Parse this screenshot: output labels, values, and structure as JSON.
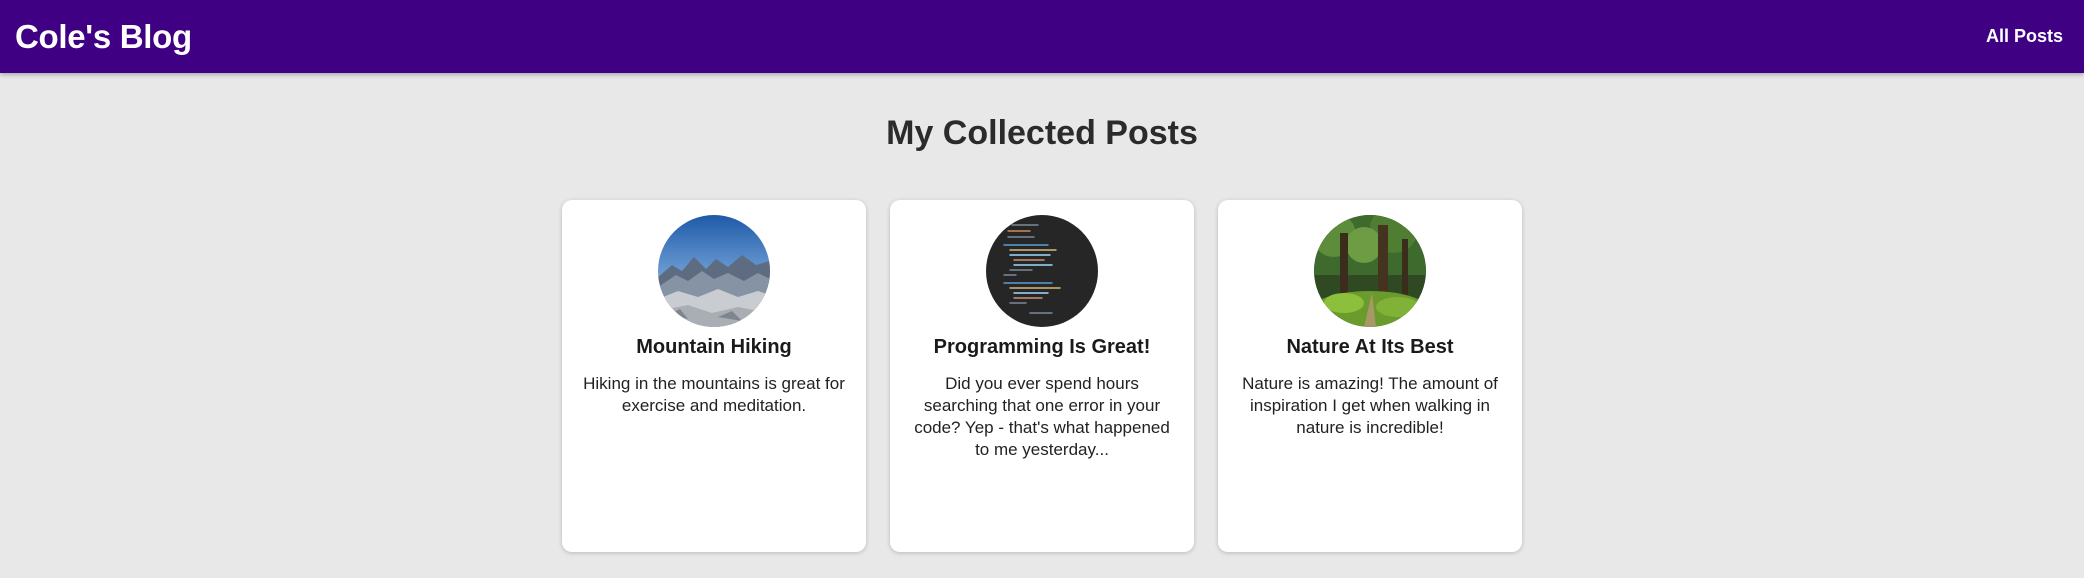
{
  "header": {
    "site_title": "Cole's Blog",
    "nav_all_posts": "All Posts",
    "background": "#3f0083"
  },
  "main": {
    "title": "My Collected Posts"
  },
  "posts": [
    {
      "title": "Mountain Hiking",
      "excerpt": "Hiking in the mountains is great for exercise and meditation.",
      "image": "mountains-photo"
    },
    {
      "title": "Programming Is Great!",
      "excerpt": "Did you ever spend hours searching that one error in your code? Yep - that's what happened to me yesterday...",
      "image": "code-screenshot"
    },
    {
      "title": "Nature At Its Best",
      "excerpt": "Nature is amazing! The amount of inspiration I get when walking in nature is incredible!",
      "image": "forest-photo"
    }
  ]
}
